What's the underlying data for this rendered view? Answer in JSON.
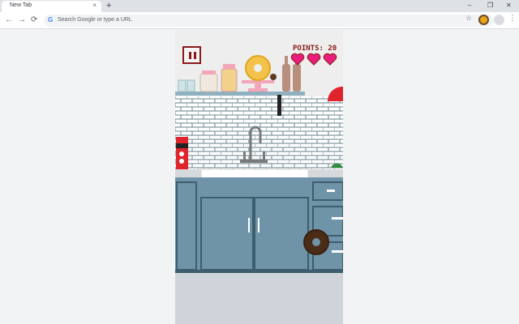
{
  "browser": {
    "tab_title": "New Tab",
    "tab_close": "×",
    "new_tab": "+",
    "win_min": "–",
    "win_max": "❐",
    "win_close": "✕",
    "back": "←",
    "forward": "→",
    "reload": "⟳",
    "omnibox_placeholder": "Search Google or type a URL",
    "google_glyph": "G",
    "bookmark": "☆",
    "menu": "⋮"
  },
  "game": {
    "points_label": "POINTS: 20",
    "lives": 3,
    "heart_color": "#e91e7a",
    "cabinet_color": "#6f94a8",
    "accent": "#8b1a1a"
  }
}
